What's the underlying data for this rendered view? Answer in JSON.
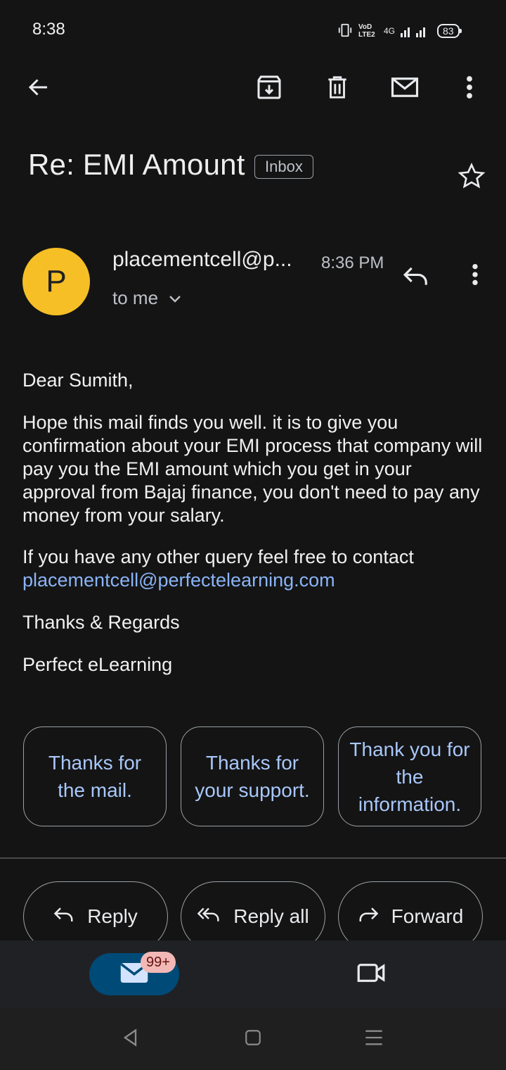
{
  "status_bar": {
    "time": "8:38",
    "network": "4G",
    "volte": "VoD LTE2",
    "battery": "83"
  },
  "toolbar": {
    "back_icon": "arrow-left-icon",
    "archive_icon": "archive-icon",
    "delete_icon": "trash-icon",
    "mark_unread_icon": "mail-icon",
    "more_icon": "more-vert-icon"
  },
  "email": {
    "subject": "Re: EMI Amount",
    "label": "Inbox",
    "sender_initial": "P",
    "sender": "placementcell@p...",
    "time": "8:36 PM",
    "recipient": "to me",
    "greeting": "Dear Sumith,",
    "paragraph1": "Hope this mail finds you well. it is to give you confirmation about your EMI process that company will pay you the EMI amount which you get in your approval from Bajaj finance, you don't need to pay any money from your salary.",
    "paragraph2": "If you have any other query feel free to contact",
    "contact_email": "placementcell@perfectelearning.com",
    "closing": "Thanks & Regards",
    "signature": "Perfect eLearning"
  },
  "smart_replies": [
    {
      "label": "Thanks for the mail."
    },
    {
      "label": "Thanks for your support."
    },
    {
      "label": "Thank you for the information."
    }
  ],
  "actions": {
    "reply": "Reply",
    "reply_all": "Reply all",
    "forward": "Forward"
  },
  "bottom_nav": {
    "mail_badge": "99+"
  },
  "colors": {
    "background": "#141414",
    "accent": "#8ab4f8",
    "avatar": "#f6bf26",
    "mail_pill": "#004a77"
  }
}
